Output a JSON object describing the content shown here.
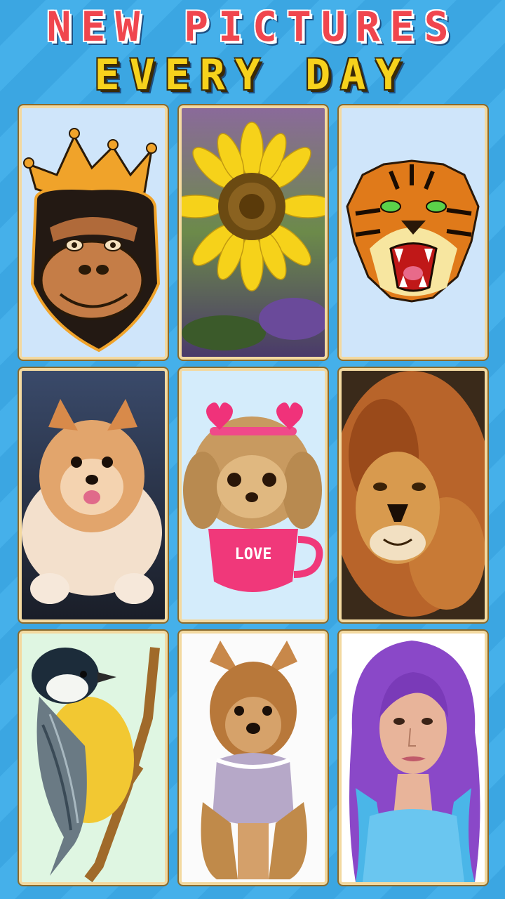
{
  "header": {
    "line1": "NEW PICTURES",
    "line2": "EVERY DAY"
  },
  "pictures": [
    {
      "subject": "crowned-gorilla"
    },
    {
      "subject": "sunflower"
    },
    {
      "subject": "tiger-face"
    },
    {
      "subject": "pomeranian-puppy"
    },
    {
      "subject": "poodle-in-love-cup"
    },
    {
      "subject": "lion"
    },
    {
      "subject": "chickadee-bird"
    },
    {
      "subject": "yorkshire-terrier"
    },
    {
      "subject": "purple-haired-woman"
    }
  ],
  "cup_text": "LOVE",
  "colors": {
    "title_red": "#f0464e",
    "title_yellow": "#f7d21c",
    "background_blue": "#3ba6e2",
    "card_border": "#f3d9a0"
  }
}
